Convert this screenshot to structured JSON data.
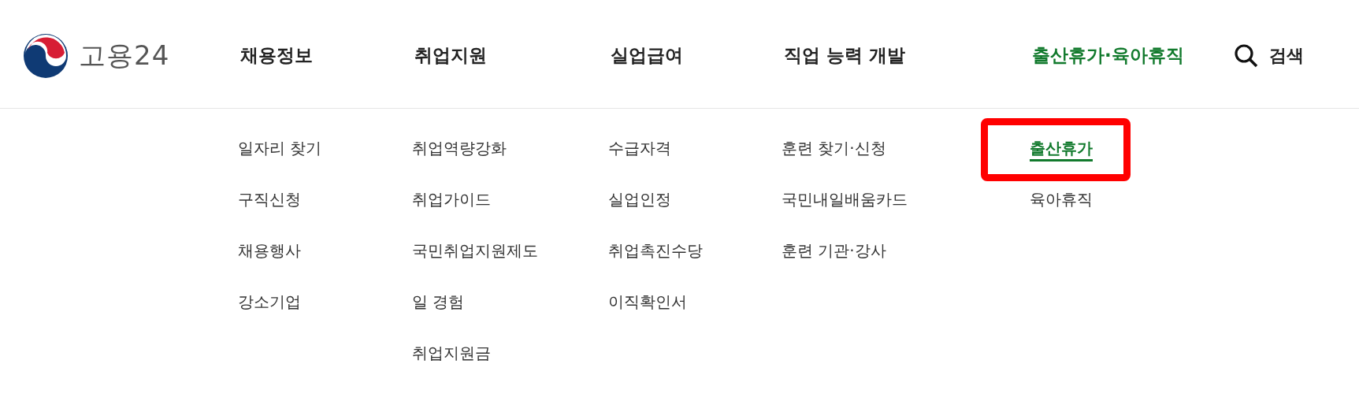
{
  "logo": {
    "text": "고용24"
  },
  "nav": [
    {
      "label": "채용정보",
      "selected": false,
      "items": [
        {
          "label": "일자리 찾기",
          "selected": false,
          "highlighted": false
        },
        {
          "label": "구직신청",
          "selected": false,
          "highlighted": false
        },
        {
          "label": "채용행사",
          "selected": false,
          "highlighted": false
        },
        {
          "label": "강소기업",
          "selected": false,
          "highlighted": false
        }
      ]
    },
    {
      "label": "취업지원",
      "selected": false,
      "items": [
        {
          "label": "취업역량강화",
          "selected": false,
          "highlighted": false
        },
        {
          "label": "취업가이드",
          "selected": false,
          "highlighted": false
        },
        {
          "label": "국민취업지원제도",
          "selected": false,
          "highlighted": false
        },
        {
          "label": "일 경험",
          "selected": false,
          "highlighted": false
        },
        {
          "label": "취업지원금",
          "selected": false,
          "highlighted": false
        }
      ]
    },
    {
      "label": "실업급여",
      "selected": false,
      "items": [
        {
          "label": "수급자격",
          "selected": false,
          "highlighted": false
        },
        {
          "label": "실업인정",
          "selected": false,
          "highlighted": false
        },
        {
          "label": "취업촉진수당",
          "selected": false,
          "highlighted": false
        },
        {
          "label": "이직확인서",
          "selected": false,
          "highlighted": false
        }
      ]
    },
    {
      "label": "직업 능력 개발",
      "selected": false,
      "items": [
        {
          "label": "훈련 찾기·신청",
          "selected": false,
          "highlighted": false
        },
        {
          "label": "국민내일배움카드",
          "selected": false,
          "highlighted": false
        },
        {
          "label": "훈련 기관·강사",
          "selected": false,
          "highlighted": false
        }
      ]
    },
    {
      "label": "출산휴가·육아휴직",
      "selected": true,
      "items": [
        {
          "label": "출산휴가",
          "selected": true,
          "highlighted": true
        },
        {
          "label": "육아휴직",
          "selected": false,
          "highlighted": false
        }
      ]
    }
  ],
  "search": {
    "label": "검색"
  }
}
